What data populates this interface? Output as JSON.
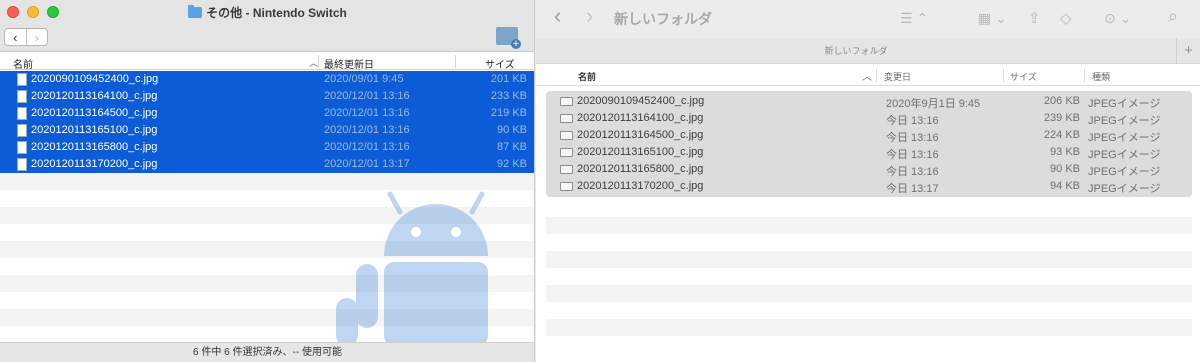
{
  "left_window": {
    "title": "その他 - Nintendo Switch",
    "nav": {
      "back": "‹",
      "forward": "›"
    },
    "columns": {
      "name": "名前",
      "modified": "最終更新日",
      "size": "サイズ"
    },
    "files": [
      {
        "name": "2020090109452400_c.jpg",
        "date": "2020/09/01 9:45",
        "size": "201 KB"
      },
      {
        "name": "2020120113164100_c.jpg",
        "date": "2020/12/01 13:16",
        "size": "233 KB"
      },
      {
        "name": "2020120113164500_c.jpg",
        "date": "2020/12/01 13:16",
        "size": "219 KB"
      },
      {
        "name": "2020120113165100_c.jpg",
        "date": "2020/12/01 13:16",
        "size": "90 KB"
      },
      {
        "name": "2020120113165800_c.jpg",
        "date": "2020/12/01 13:16",
        "size": "87 KB"
      },
      {
        "name": "2020120113170200_c.jpg",
        "date": "2020/12/01 13:17",
        "size": "92 KB"
      }
    ],
    "status": "6 件中 6 件選択済み、-- 使用可能"
  },
  "right_window": {
    "title": "新しいフォルダ",
    "tab_label": "新しいフォルダ",
    "nav": {
      "back": "‹",
      "forward": "›"
    },
    "toolbar": {
      "view": "☰ ⌃",
      "group": "▦ ⌄",
      "share": "⇪",
      "tag": "◇",
      "more": "⊙ ⌄",
      "search": "⌕"
    },
    "plus": "+",
    "columns": {
      "name": "名前",
      "modified": "変更日",
      "size": "サイズ",
      "kind": "種類"
    },
    "files": [
      {
        "name": "2020090109452400_c.jpg",
        "date": "2020年9月1日 9:45",
        "size": "206 KB",
        "kind": "JPEGイメージ"
      },
      {
        "name": "2020120113164100_c.jpg",
        "date": "今日 13:16",
        "size": "239 KB",
        "kind": "JPEGイメージ"
      },
      {
        "name": "2020120113164500_c.jpg",
        "date": "今日 13:16",
        "size": "224 KB",
        "kind": "JPEGイメージ"
      },
      {
        "name": "2020120113165100_c.jpg",
        "date": "今日 13:16",
        "size": "93 KB",
        "kind": "JPEGイメージ"
      },
      {
        "name": "2020120113165800_c.jpg",
        "date": "今日 13:16",
        "size": "90 KB",
        "kind": "JPEGイメージ"
      },
      {
        "name": "2020120113170200_c.jpg",
        "date": "今日 13:17",
        "size": "94 KB",
        "kind": "JPEGイメージ"
      }
    ]
  }
}
